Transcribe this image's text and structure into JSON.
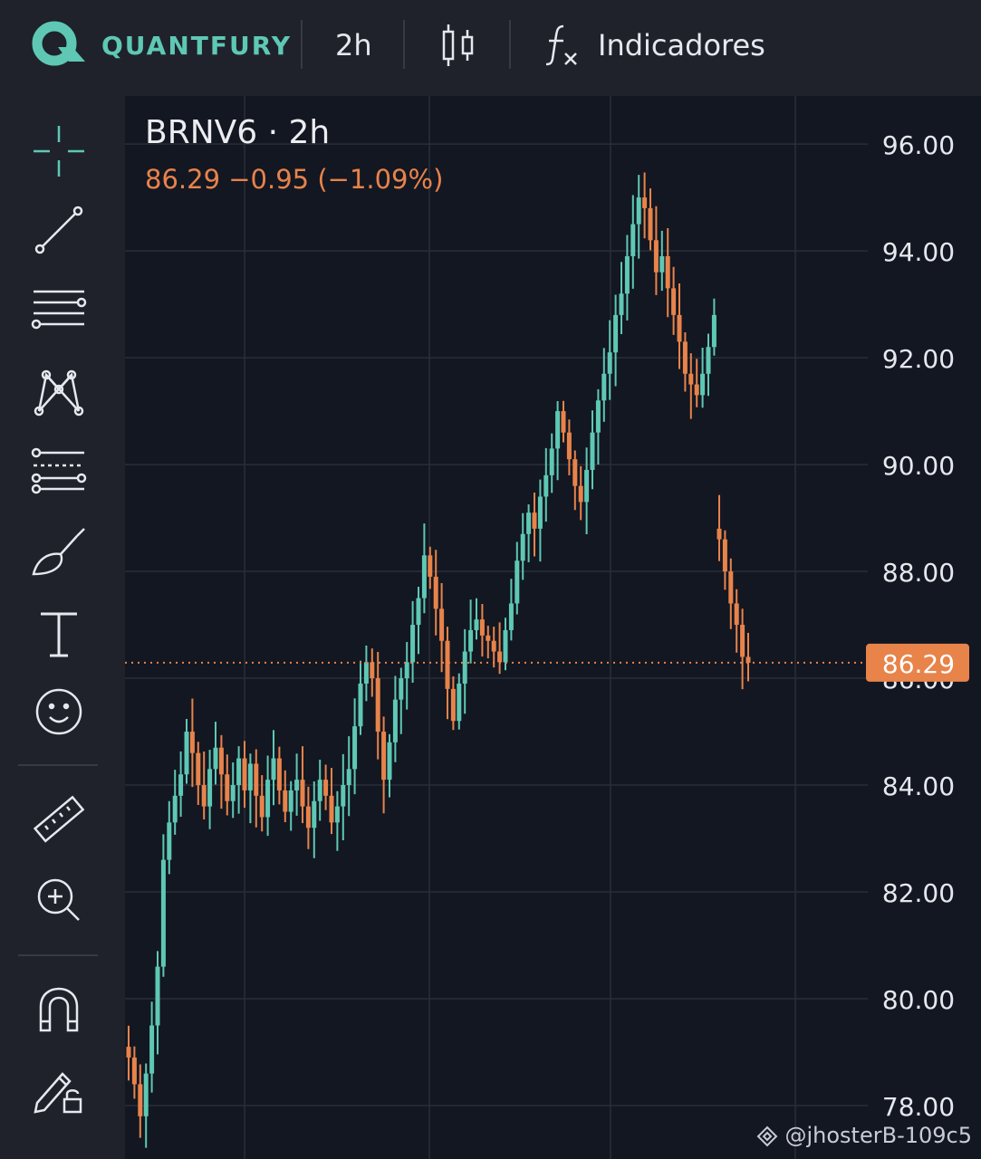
{
  "header": {
    "brand": "QUANTFURY",
    "interval": "2h",
    "indicators_label": "Indicadores"
  },
  "sidebar": {
    "tools": [
      "crosshair-icon",
      "trend-line-icon",
      "horizontal-lines-icon",
      "pattern-icon",
      "fib-icon",
      "brush-icon",
      "text-icon",
      "emoji-icon",
      "ruler-icon",
      "zoom-in-icon",
      "magnet-icon",
      "lock-drawings-icon"
    ]
  },
  "legend": {
    "symbol": "BRNV6 · 2h",
    "quote": "86.29  −0.95 (−1.09%)"
  },
  "colors": {
    "up": "#5ec8b4",
    "down": "#e8834a",
    "background": "#131722",
    "grid": "#2a2e39"
  },
  "chart_data": {
    "type": "candlestick",
    "symbol": "BRNV6",
    "interval": "2h",
    "ylim": [
      77,
      96.9
    ],
    "y_ticks": [
      78,
      80,
      82,
      84,
      86,
      88,
      90,
      92,
      94,
      96
    ],
    "y_tick_labels": [
      "78.00",
      "80.00",
      "82.00",
      "84.00",
      "86.00",
      "88.00",
      "90.00",
      "92.00",
      "94.00",
      "96.00"
    ],
    "last_price": 86.29,
    "last_price_label": "86.29",
    "change": -0.95,
    "change_pct": -1.09,
    "close_path": [
      78.9,
      78.4,
      77.8,
      78.6,
      79.5,
      80.6,
      82.6,
      83.3,
      83.8,
      84.2,
      85.0,
      84.6,
      84.0,
      83.6,
      84.3,
      84.7,
      84.2,
      83.7,
      84.0,
      84.5,
      83.9,
      84.4,
      83.8,
      83.4,
      84.1,
      84.5,
      83.9,
      83.5,
      83.9,
      84.1,
      83.6,
      83.2,
      83.7,
      84.1,
      83.8,
      83.3,
      83.6,
      84.0,
      84.3,
      85.1,
      85.9,
      86.3,
      86.0,
      85.0,
      84.1,
      84.8,
      85.6,
      86.0,
      86.3,
      87.0,
      87.5,
      88.3,
      87.9,
      87.3,
      86.7,
      85.8,
      85.2,
      85.9,
      86.5,
      86.9,
      87.1,
      86.8,
      86.7,
      86.5,
      86.3,
      86.9,
      87.4,
      88.2,
      88.7,
      89.1,
      88.8,
      89.4,
      89.8,
      90.3,
      91.0,
      90.6,
      90.1,
      89.6,
      89.3,
      89.9,
      90.6,
      91.2,
      91.7,
      92.1,
      92.8,
      93.2,
      93.9,
      94.5,
      95.0,
      94.8,
      94.2,
      93.6,
      93.9,
      93.3,
      92.8,
      92.3,
      91.7,
      91.5,
      91.3,
      91.7,
      92.2,
      92.8
    ],
    "gap_segment_close_path": [
      88.6,
      88.0,
      87.4,
      87.0,
      86.4,
      86.29
    ]
  }
}
